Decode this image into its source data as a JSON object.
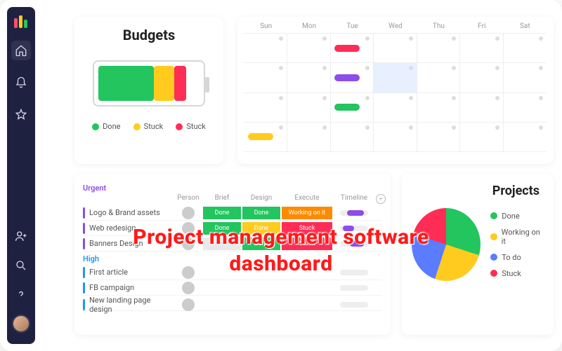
{
  "sidebar": {
    "icons": [
      "home",
      "bell",
      "star",
      "add-user",
      "search",
      "help"
    ]
  },
  "budgets": {
    "title": "Budgets",
    "legend": [
      {
        "label": "Done",
        "color": "#22c55e"
      },
      {
        "label": "Stuck",
        "color": "#ffcb1f"
      },
      {
        "label": "Stuck",
        "color": "#ff2d55"
      }
    ]
  },
  "calendar": {
    "days": [
      "Sun",
      "Mon",
      "Tue",
      "Wed",
      "Thu",
      "Fri",
      "Sat"
    ],
    "events": [
      {
        "row": 0,
        "col": 2,
        "span": 1,
        "color": "#ff2d55"
      },
      {
        "row": 1,
        "col": 2,
        "span": 1,
        "color": "#8d4de8",
        "hilite_col": 3
      },
      {
        "row": 2,
        "col": 2,
        "span": 1,
        "color": "#22c55e"
      },
      {
        "row": 3,
        "col": 0,
        "span": 1,
        "color": "#ffcb1f"
      }
    ]
  },
  "tasks": {
    "columns": [
      "",
      "Person",
      "Brief",
      "Design",
      "Execute",
      "Timeline",
      ""
    ],
    "groups": [
      {
        "name": "Urgent",
        "color": "#8d4de8",
        "rows": [
          {
            "name": "Logo & Brand assets",
            "brief": {
              "t": "Done",
              "c": "#22c55e"
            },
            "design": {
              "t": "Done",
              "c": "#22c55e"
            },
            "execute": {
              "t": "Working on it",
              "c": "#ff8a00"
            },
            "tl": {
              "c": "#8d4de8",
              "l": 10,
              "w": 24
            }
          },
          {
            "name": "Web redesign",
            "brief": {
              "t": "Done",
              "c": "#22c55e"
            },
            "design": {
              "t": "Done",
              "c": "#ffcb1f"
            },
            "execute": {
              "t": "Stuck",
              "c": "#ff2d55"
            },
            "tl": {
              "c": "#8d4de8",
              "l": 4,
              "w": 16
            }
          },
          {
            "name": "Banners Design",
            "brief": {
              "t": "",
              "c": "#e9e9e9"
            },
            "design": {
              "t": "Done",
              "c": "#22c55e"
            },
            "execute": {
              "t": "Stuck",
              "c": "#ff2d55"
            },
            "tl": {
              "c": "#8d4de8",
              "l": 14,
              "w": 20
            }
          }
        ]
      },
      {
        "name": "High",
        "color": "#2196f3",
        "rows": [
          {
            "name": "First article",
            "brief": {
              "t": "",
              "c": ""
            },
            "design": {
              "t": "",
              "c": ""
            },
            "execute": {
              "t": "",
              "c": ""
            },
            "tl": {
              "c": "#2196f3",
              "l": 0,
              "w": 0
            }
          },
          {
            "name": "FB campaign",
            "brief": {
              "t": "",
              "c": ""
            },
            "design": {
              "t": "",
              "c": ""
            },
            "execute": {
              "t": "",
              "c": ""
            },
            "tl": {
              "c": "#2196f3",
              "l": 0,
              "w": 0
            }
          },
          {
            "name": "New landing page design",
            "brief": {
              "t": "",
              "c": ""
            },
            "design": {
              "t": "",
              "c": ""
            },
            "execute": {
              "t": "",
              "c": ""
            },
            "tl": {
              "c": "#2196f3",
              "l": 0,
              "w": 0
            }
          }
        ]
      }
    ]
  },
  "projects": {
    "title": "Projects",
    "legend": [
      {
        "label": "Done",
        "color": "#22c55e"
      },
      {
        "label": "Working on it",
        "color": "#ffcb1f"
      },
      {
        "label": "To do",
        "color": "#5b7cff"
      },
      {
        "label": "Stuck",
        "color": "#ff2d55"
      }
    ]
  },
  "overlay": {
    "line1": "Project management software",
    "line2": "dashboard"
  },
  "chart_data": [
    {
      "type": "bar",
      "title": "Budgets",
      "series": [
        {
          "name": "Done",
          "value": 55,
          "color": "#22c55e"
        },
        {
          "name": "Stuck",
          "value": 20,
          "color": "#ffcb1f"
        },
        {
          "name": "Stuck",
          "value": 12,
          "color": "#ff2d55"
        }
      ],
      "total_width_pct": 87
    },
    {
      "type": "pie",
      "title": "Projects",
      "series": [
        {
          "name": "Done",
          "value": 30,
          "color": "#22c55e"
        },
        {
          "name": "Working on it",
          "value": 25,
          "color": "#ffcb1f"
        },
        {
          "name": "To do",
          "value": 25,
          "color": "#5b7cff"
        },
        {
          "name": "Stuck",
          "value": 20,
          "color": "#ff2d55"
        }
      ]
    }
  ]
}
